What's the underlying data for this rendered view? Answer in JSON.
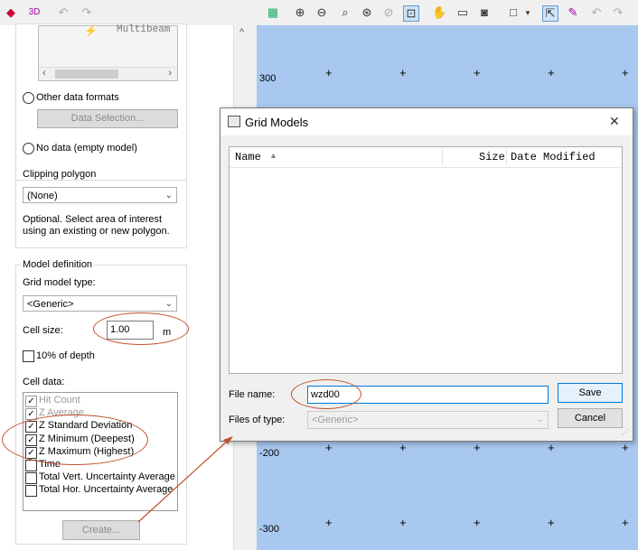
{
  "left_panel": {
    "preview_text": "Multibeam",
    "other_formats_label": "Other data formats",
    "data_selection_button": "Data Selection...",
    "no_data_label": "No data (empty model)",
    "clipping": {
      "group_label": "Clipping polygon",
      "selected": "(None)",
      "help_text_1": "Optional. Select area of interest",
      "help_text_2": "using an existing or new polygon."
    },
    "model_definition": {
      "group_label": "Model definition",
      "grid_type_label": "Grid model type:",
      "grid_type_selected": "<Generic>",
      "cell_size_label": "Cell size:",
      "cell_size_value": "1.00",
      "cell_size_unit": "m",
      "depth_pct_label": "10% of depth",
      "cell_data_label": "Cell data:",
      "cell_data_items": [
        {
          "label": "Hit Count",
          "checked": true,
          "disabled": true
        },
        {
          "label": "Z Average",
          "checked": true,
          "disabled": true
        },
        {
          "label": "Z Standard Deviation",
          "checked": true,
          "disabled": false
        },
        {
          "label": "Z Minimum (Deepest)",
          "checked": true,
          "disabled": false
        },
        {
          "label": "Z Maximum (Highest)",
          "checked": true,
          "disabled": false
        },
        {
          "label": "Time",
          "checked": false,
          "disabled": false
        },
        {
          "label": "Total Vert. Uncertainty Average",
          "checked": false,
          "disabled": false
        },
        {
          "label": "Total Hor. Uncertainty Average",
          "checked": false,
          "disabled": false
        }
      ]
    },
    "create_button": "Create..."
  },
  "map": {
    "axis_labels": [
      "300",
      "-200",
      "-300"
    ],
    "tick_marker": "+"
  },
  "dialog": {
    "title": "Grid Models",
    "close_glyph": "✕",
    "columns": {
      "name": "Name",
      "size": "Size",
      "date_modified": "Date Modified"
    },
    "file_name_label": "File name:",
    "file_name_value": "wzd00",
    "files_of_type_label": "Files of type:",
    "files_of_type_value": "<Generic>",
    "save_button": "Save",
    "cancel_button": "Cancel"
  },
  "colors": {
    "annotation": "#c0502a",
    "map_background": "#a8c8f0",
    "accent": "#0078d7"
  }
}
